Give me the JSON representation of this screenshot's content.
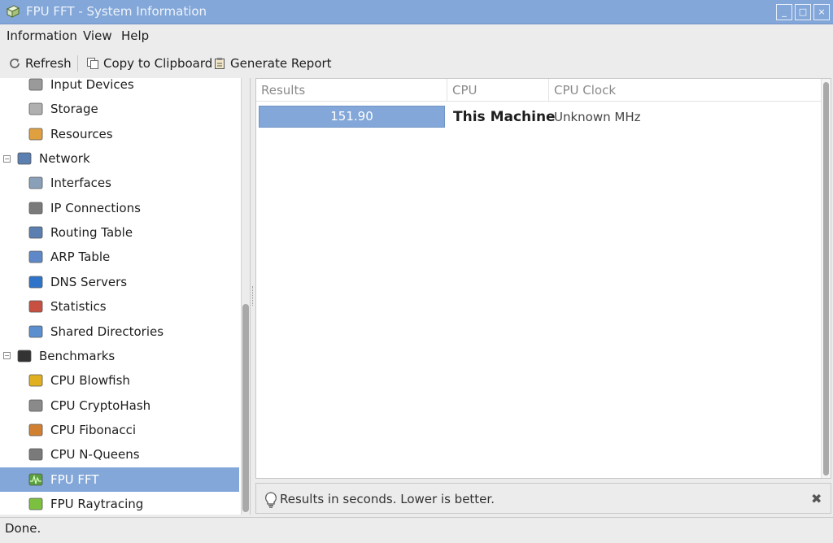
{
  "window": {
    "title": "FPU FFT - System Information",
    "controls": [
      "_",
      "□",
      "×"
    ]
  },
  "menu": [
    "Information",
    "View",
    "Help"
  ],
  "toolbar": {
    "refresh": "Refresh",
    "copy": "Copy to Clipboard",
    "report": "Generate Report"
  },
  "sidebar": {
    "items": [
      {
        "label": "Input Devices",
        "icon": "input-devices-icon",
        "level": "child"
      },
      {
        "label": "Storage",
        "icon": "storage-icon",
        "level": "child"
      },
      {
        "label": "Resources",
        "icon": "resources-icon",
        "level": "child"
      },
      {
        "label": "Network",
        "icon": "network-icon",
        "level": "parent",
        "expander": "⊟"
      },
      {
        "label": "Interfaces",
        "icon": "interfaces-icon",
        "level": "child"
      },
      {
        "label": "IP Connections",
        "icon": "ip-connections-icon",
        "level": "child"
      },
      {
        "label": "Routing Table",
        "icon": "routing-table-icon",
        "level": "child"
      },
      {
        "label": "ARP Table",
        "icon": "arp-table-icon",
        "level": "child"
      },
      {
        "label": "DNS Servers",
        "icon": "dns-servers-icon",
        "level": "child"
      },
      {
        "label": "Statistics",
        "icon": "statistics-icon",
        "level": "child"
      },
      {
        "label": "Shared Directories",
        "icon": "shared-directories-icon",
        "level": "child"
      },
      {
        "label": "Benchmarks",
        "icon": "benchmarks-icon",
        "level": "parent",
        "expander": "⊟"
      },
      {
        "label": "CPU Blowfish",
        "icon": "blowfish-icon",
        "level": "child"
      },
      {
        "label": "CPU CryptoHash",
        "icon": "cryptohash-icon",
        "level": "child"
      },
      {
        "label": "CPU Fibonacci",
        "icon": "fibonacci-icon",
        "level": "child"
      },
      {
        "label": "CPU N-Queens",
        "icon": "n-queens-icon",
        "level": "child"
      },
      {
        "label": "FPU FFT",
        "icon": "fpu-fft-icon",
        "level": "child",
        "selected": true
      },
      {
        "label": "FPU Raytracing",
        "icon": "raytracing-icon",
        "level": "child"
      }
    ]
  },
  "results": {
    "columns": [
      "Results",
      "CPU",
      "CPU Clock"
    ],
    "rows": [
      {
        "result": "151.90",
        "cpu": "This Machine",
        "clock": "Unknown MHz"
      }
    ]
  },
  "info": {
    "message": "Results in seconds. Lower is better.",
    "close": "✖"
  },
  "status": "Done.",
  "colors": {
    "accent": "#83a7d8",
    "selection_text": "#ffffff",
    "background": "#ececec"
  }
}
